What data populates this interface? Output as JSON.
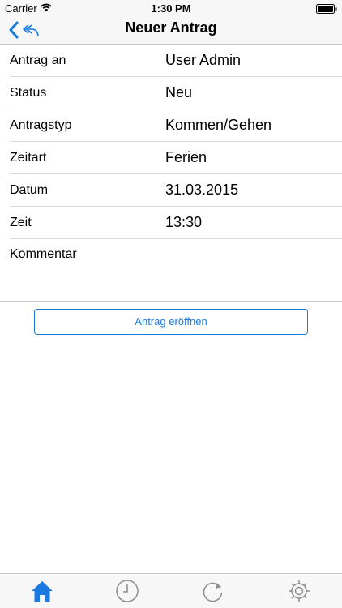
{
  "status_bar": {
    "carrier": "Carrier",
    "time": "1:30 PM"
  },
  "nav": {
    "title": "Neuer Antrag"
  },
  "form": {
    "rows": [
      {
        "label": "Antrag an",
        "value": "User Admin"
      },
      {
        "label": "Status",
        "value": "Neu"
      },
      {
        "label": "Antragstyp",
        "value": "Kommen/Gehen"
      },
      {
        "label": "Zeitart",
        "value": "Ferien"
      },
      {
        "label": "Datum",
        "value": "31.03.2015"
      },
      {
        "label": "Zeit",
        "value": "13:30"
      }
    ],
    "comment_label": "Kommentar"
  },
  "actions": {
    "submit_label": "Antrag eröffnen"
  },
  "tabs": [
    {
      "icon": "home-icon",
      "active": true
    },
    {
      "icon": "clock-icon",
      "active": false
    },
    {
      "icon": "refresh-icon",
      "active": false
    },
    {
      "icon": "gear-icon",
      "active": false
    }
  ],
  "colors": {
    "accent": "#1a7ae0",
    "inactive_icon": "#8e8e93",
    "bar_background": "#f7f7f7"
  }
}
